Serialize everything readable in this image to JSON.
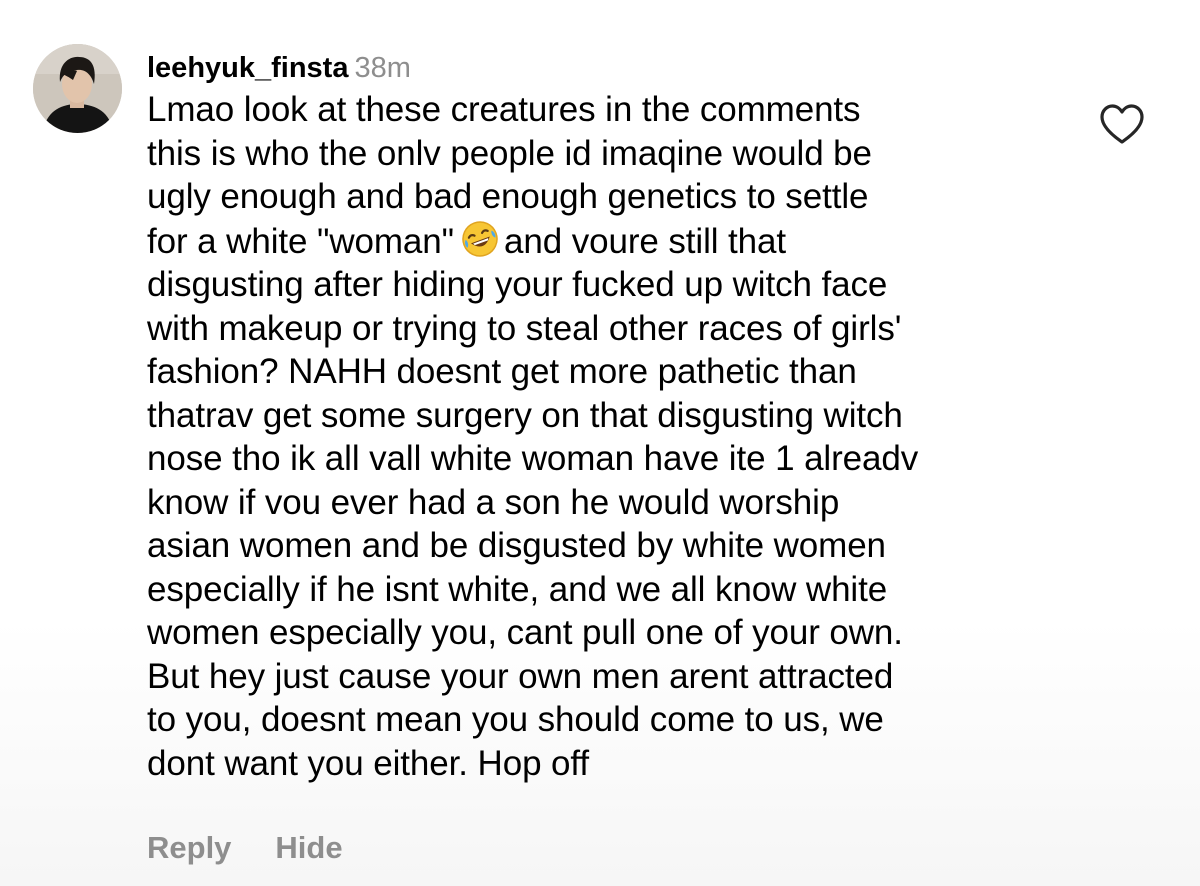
{
  "comment": {
    "username": "leehyuk_finsta",
    "time": "38m",
    "lines": {
      "l1": "Lmao look at these creatures in the comments",
      "l2": "this is who the onlv people id imaqine would be",
      "l3": "ugly enough and bad enough genetics to settle",
      "l4a": "for a white \"woman\"",
      "l4b": "and voure still that",
      "l5": "disgusting after hiding your fucked up witch face",
      "l6": "with makeup or trying to steal other races of girls'",
      "l7": "fashion? NAHH doesnt get more pathetic than",
      "l8": "thatrav get some surgery on that disgusting witch",
      "l9": "nose tho ik all vall white woman have ite 1 alreadv",
      "l10": "know if vou ever had a son he would worship",
      "l11": "asian women and be disgusted by white women",
      "l12": "especially if he isnt white, and we all know white",
      "l13": "women especially you, cant pull one of your own.",
      "l14": "But hey just cause your own men arent attracted",
      "l15": "to you, doesnt mean you should come to us, we",
      "l16": "dont want you either. Hop off"
    },
    "emoji": "rolling-on-floor-laughing-emoji"
  },
  "actions": {
    "reply_label": "Reply",
    "hide_label": "Hide"
  },
  "icons": {
    "like": "heart-outline-icon"
  },
  "colors": {
    "username": "#000000",
    "meta_gray": "#8e8e8e",
    "text": "#000000",
    "background": "#ffffff"
  }
}
